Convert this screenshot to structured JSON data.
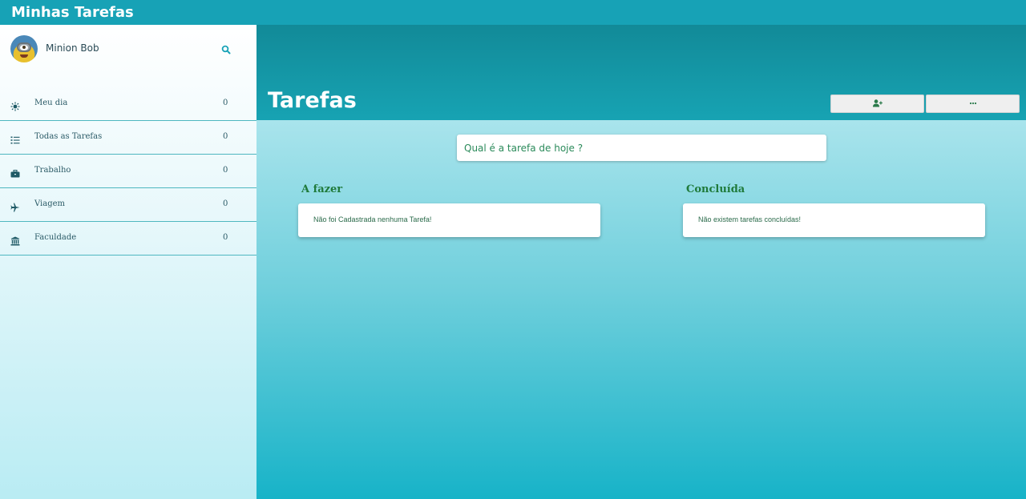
{
  "app": {
    "title": "Minhas Tarefas"
  },
  "user": {
    "name": "Minion Bob"
  },
  "sidebar": {
    "items": [
      {
        "label": "Meu dia",
        "count": "0",
        "icon": "sun-icon"
      },
      {
        "label": "Todas as Tarefas",
        "count": "0",
        "icon": "list-icon"
      },
      {
        "label": "Trabalho",
        "count": "0",
        "icon": "briefcase-icon"
      },
      {
        "label": "Viagem",
        "count": "0",
        "icon": "plane-icon"
      },
      {
        "label": "Faculdade",
        "count": "0",
        "icon": "institution-icon"
      }
    ]
  },
  "header": {
    "title": "Tarefas"
  },
  "input": {
    "placeholder": "Qual é a tarefa de hoje ?"
  },
  "columns": {
    "todo": {
      "title": "A fazer",
      "empty": "Não foi Cadastrada nenhuma Tarefa!"
    },
    "done": {
      "title": "Concluída",
      "empty": "Não existem tarefas concluídas!"
    }
  },
  "colors": {
    "accent": "#17a2b6",
    "text_green": "#1f7a3a"
  }
}
